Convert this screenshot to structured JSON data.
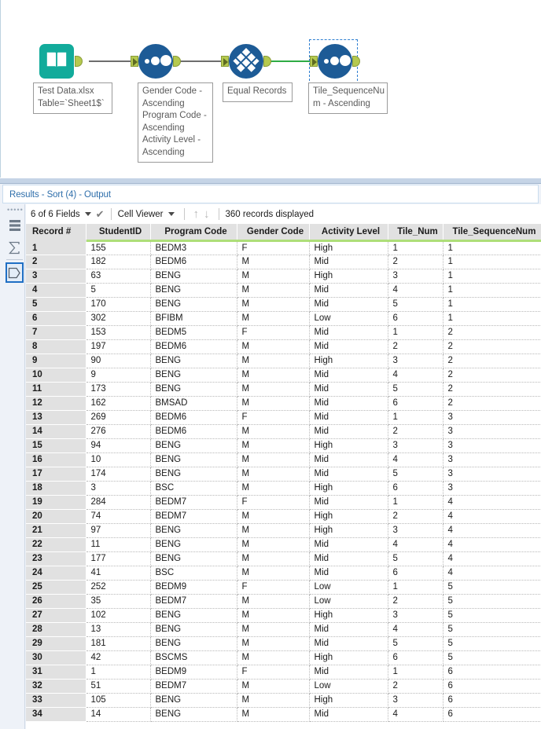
{
  "canvas": {
    "nodes": [
      {
        "name": "input-data-node",
        "icon": "book-icon",
        "label": "Test Data.xlsx\nTable=`Sheet1$`",
        "selected": false
      },
      {
        "name": "sort-node",
        "icon": "sort-dots-icon",
        "label": "Gender Code -\nAscending\nProgram Code -\nAscending\nActivity Level -\nAscending",
        "selected": false
      },
      {
        "name": "tile-node",
        "icon": "tile-diamond-icon",
        "label": "Equal Records",
        "selected": false
      },
      {
        "name": "sort-node-2",
        "icon": "sort-dots-icon",
        "label": "Tile_SequenceNu\nm - Ascending",
        "selected": true
      }
    ],
    "colors": {
      "input_node": "#12ab9b",
      "tool_node": "#1d5b96",
      "port": "#b5c94f",
      "wire": "#6d6d6d",
      "wire_active": "#2eac44",
      "selection": "#2f7fd1"
    }
  },
  "results": {
    "tab_title": "Results - Sort (4) - Output",
    "rail": {
      "grip": "grip-dots",
      "items": [
        {
          "name": "data-view-icon",
          "selected": false
        },
        {
          "name": "sigma-summary-icon",
          "selected": false
        },
        {
          "name": "output-anchor-icon",
          "selected": true
        }
      ]
    },
    "toolbar": {
      "fields_label": "6 of 6 Fields",
      "check_icon": "checkmark-icon",
      "viewer_label": "Cell Viewer",
      "up_icon": "arrow-up-icon",
      "down_icon": "arrow-down-icon",
      "records_label": "360 records displayed"
    },
    "grid": {
      "columns": [
        "Record #",
        "StudentID",
        "Program Code",
        "Gender Code",
        "Activity Level",
        "Tile_Num",
        "Tile_SequenceNum"
      ],
      "header_underline_color": "#aede79",
      "rows": [
        [
          "1",
          "155",
          "BEDM3",
          "F",
          "High",
          "1",
          "1"
        ],
        [
          "2",
          "182",
          "BEDM6",
          "M",
          "Mid",
          "2",
          "1"
        ],
        [
          "3",
          "63",
          "BENG",
          "M",
          "High",
          "3",
          "1"
        ],
        [
          "4",
          "5",
          "BENG",
          "M",
          "Mid",
          "4",
          "1"
        ],
        [
          "5",
          "170",
          "BENG",
          "M",
          "Mid",
          "5",
          "1"
        ],
        [
          "6",
          "302",
          "BFIBM",
          "M",
          "Low",
          "6",
          "1"
        ],
        [
          "7",
          "153",
          "BEDM5",
          "F",
          "Mid",
          "1",
          "2"
        ],
        [
          "8",
          "197",
          "BEDM6",
          "M",
          "Mid",
          "2",
          "2"
        ],
        [
          "9",
          "90",
          "BENG",
          "M",
          "High",
          "3",
          "2"
        ],
        [
          "10",
          "9",
          "BENG",
          "M",
          "Mid",
          "4",
          "2"
        ],
        [
          "11",
          "173",
          "BENG",
          "M",
          "Mid",
          "5",
          "2"
        ],
        [
          "12",
          "162",
          "BMSAD",
          "M",
          "Mid",
          "6",
          "2"
        ],
        [
          "13",
          "269",
          "BEDM6",
          "F",
          "Mid",
          "1",
          "3"
        ],
        [
          "14",
          "276",
          "BEDM6",
          "M",
          "Mid",
          "2",
          "3"
        ],
        [
          "15",
          "94",
          "BENG",
          "M",
          "High",
          "3",
          "3"
        ],
        [
          "16",
          "10",
          "BENG",
          "M",
          "Mid",
          "4",
          "3"
        ],
        [
          "17",
          "174",
          "BENG",
          "M",
          "Mid",
          "5",
          "3"
        ],
        [
          "18",
          "3",
          "BSC",
          "M",
          "High",
          "6",
          "3"
        ],
        [
          "19",
          "284",
          "BEDM7",
          "F",
          "Mid",
          "1",
          "4"
        ],
        [
          "20",
          "74",
          "BEDM7",
          "M",
          "High",
          "2",
          "4"
        ],
        [
          "21",
          "97",
          "BENG",
          "M",
          "High",
          "3",
          "4"
        ],
        [
          "22",
          "11",
          "BENG",
          "M",
          "Mid",
          "4",
          "4"
        ],
        [
          "23",
          "177",
          "BENG",
          "M",
          "Mid",
          "5",
          "4"
        ],
        [
          "24",
          "41",
          "BSC",
          "M",
          "Mid",
          "6",
          "4"
        ],
        [
          "25",
          "252",
          "BEDM9",
          "F",
          "Low",
          "1",
          "5"
        ],
        [
          "26",
          "35",
          "BEDM7",
          "M",
          "Low",
          "2",
          "5"
        ],
        [
          "27",
          "102",
          "BENG",
          "M",
          "High",
          "3",
          "5"
        ],
        [
          "28",
          "13",
          "BENG",
          "M",
          "Mid",
          "4",
          "5"
        ],
        [
          "29",
          "181",
          "BENG",
          "M",
          "Mid",
          "5",
          "5"
        ],
        [
          "30",
          "42",
          "BSCMS",
          "M",
          "High",
          "6",
          "5"
        ],
        [
          "31",
          "1",
          "BEDM9",
          "F",
          "Mid",
          "1",
          "6"
        ],
        [
          "32",
          "51",
          "BEDM7",
          "M",
          "Low",
          "2",
          "6"
        ],
        [
          "33",
          "105",
          "BENG",
          "M",
          "High",
          "3",
          "6"
        ],
        [
          "34",
          "14",
          "BENG",
          "M",
          "Mid",
          "4",
          "6"
        ]
      ]
    }
  }
}
